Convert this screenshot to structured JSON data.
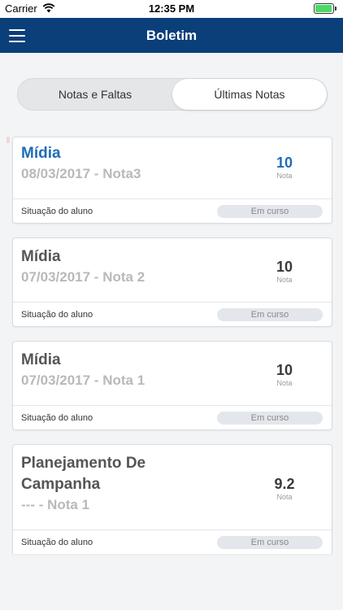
{
  "status_bar": {
    "carrier": "Carrier",
    "time": "12:35 PM",
    "battery_level": 1.0
  },
  "header": {
    "title": "Boletim",
    "menu_icon": "hamburger-menu-icon"
  },
  "tabs": [
    {
      "label": "Notas e Faltas",
      "selected": false
    },
    {
      "label": "Últimas Notas",
      "selected": true
    }
  ],
  "cards": [
    {
      "course": "Mídia",
      "date_note": "08/03/2017 - Nota3",
      "grade": "10",
      "grade_label": "Nota",
      "situacao_label": "Situação do aluno",
      "status": "Em curso",
      "accent": "#1e6db8"
    },
    {
      "course": "Mídia",
      "date_note": "07/03/2017 - Nota 2",
      "grade": "10",
      "grade_label": "Nota",
      "situacao_label": "Situação do aluno",
      "status": "Em curso"
    },
    {
      "course": "Mídia",
      "date_note": "07/03/2017 - Nota 1",
      "grade": "10",
      "grade_label": "Nota",
      "situacao_label": "Situação do aluno",
      "status": "Em curso"
    },
    {
      "course_line1": "Planejamento De",
      "course_line2": "Campanha",
      "date_note": "--- - Nota 1",
      "grade": "9.2",
      "grade_label": "Nota",
      "situacao_label": "Situação do aluno",
      "status": "Em curso"
    }
  ],
  "colors": {
    "header_bg": "#0b3f7a",
    "accent": "#1e6db8",
    "background": "#f2f4f5"
  }
}
